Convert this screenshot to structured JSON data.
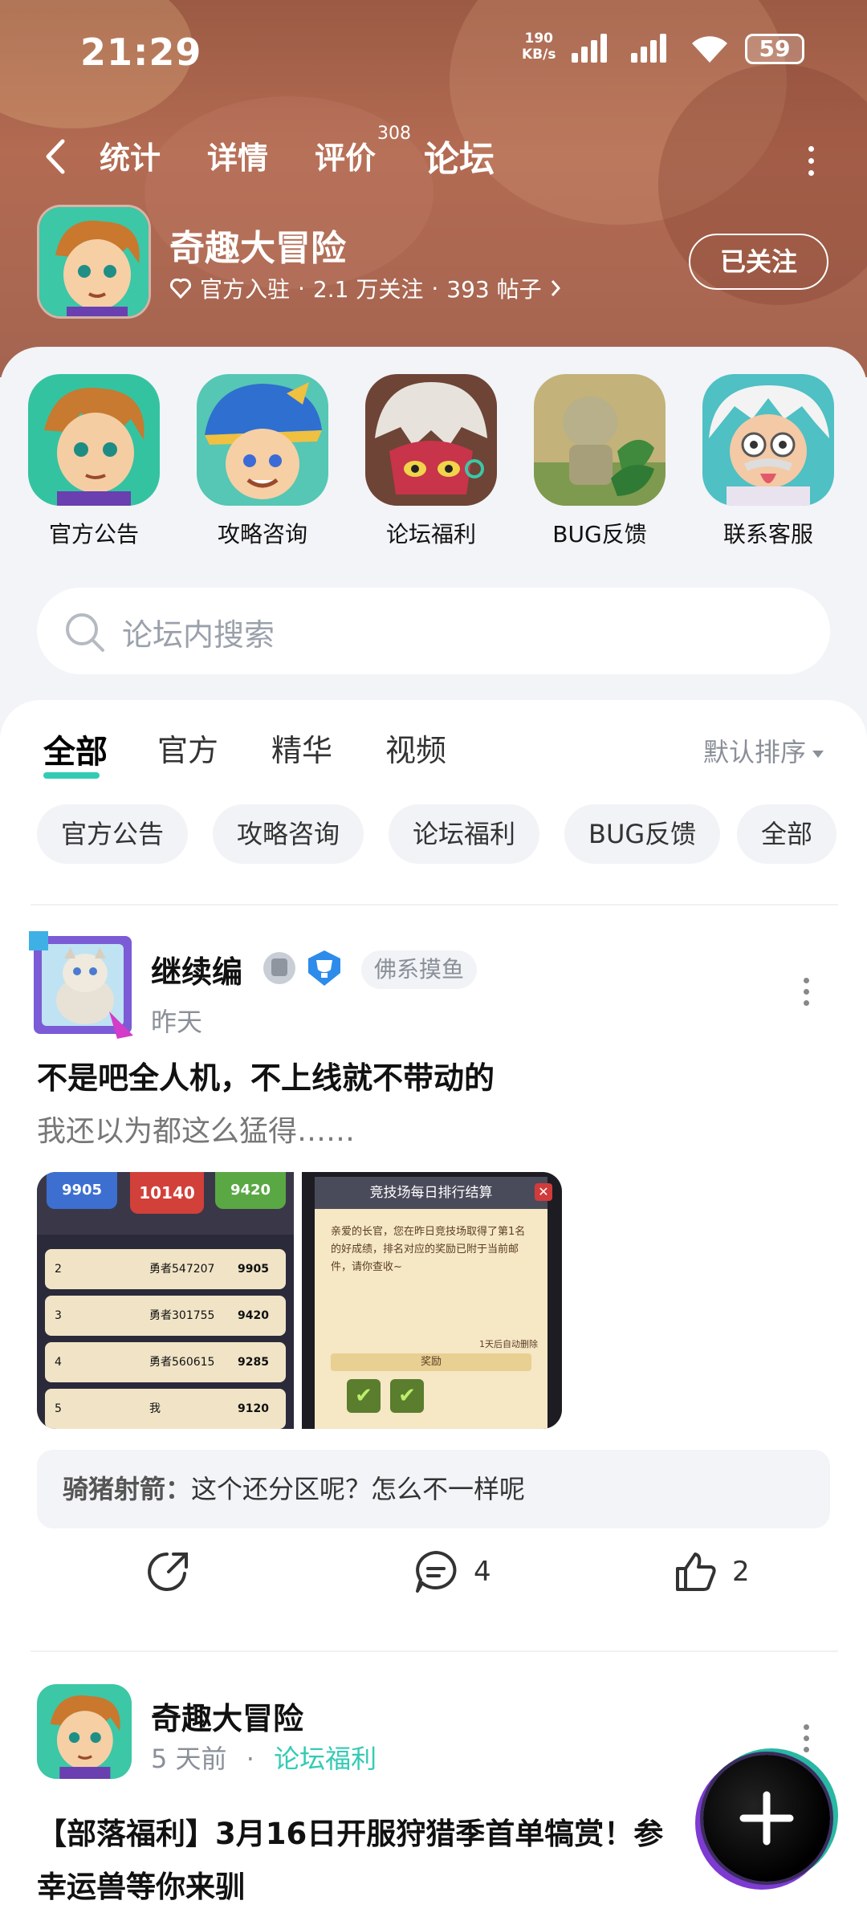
{
  "status_bar": {
    "time": "21:29",
    "net_speed_value": "190",
    "net_speed_unit": "KB/s",
    "battery": "59"
  },
  "nav": {
    "tabs": [
      {
        "label": "统计"
      },
      {
        "label": "详情"
      },
      {
        "label": "评价",
        "count": "308"
      },
      {
        "label": "论坛",
        "active": true
      }
    ]
  },
  "game": {
    "title": "奇趣大冒险",
    "badge": "官方入驻",
    "followers": "2.1 万关注",
    "posts": "393 帖子",
    "follow_label": "已关注"
  },
  "categories": [
    {
      "label": "官方公告",
      "icon": "hero-boy-icon"
    },
    {
      "label": "攻略咨询",
      "icon": "pirate-hero-icon"
    },
    {
      "label": "论坛福利",
      "icon": "dino-skull-icon"
    },
    {
      "label": "BUG反馈",
      "icon": "stone-statue-icon"
    },
    {
      "label": "联系客服",
      "icon": "scientist-icon"
    }
  ],
  "search": {
    "placeholder": "论坛内搜索"
  },
  "feed": {
    "tabs": [
      "全部",
      "官方",
      "精华",
      "视频"
    ],
    "sort_label": "默认排序",
    "chips": [
      "官方公告",
      "攻略咨询",
      "论坛福利",
      "BUG反馈",
      "全部"
    ]
  },
  "posts": [
    {
      "author": "继续编",
      "tag": "佛系摸鱼",
      "time": "昨天",
      "title": "不是吧全人机，不上线就不带动的",
      "excerpt": "我还以为都这么猛得……",
      "image1": {
        "top_scores": [
          "9905",
          "10140",
          "9420"
        ],
        "rows": [
          {
            "rank": "2",
            "name": "勇者547207",
            "score": "9905"
          },
          {
            "rank": "3",
            "name": "勇者301755",
            "score": "9420"
          },
          {
            "rank": "4",
            "name": "勇者560615",
            "score": "9285"
          },
          {
            "rank": "5",
            "name": "我",
            "score": "9120"
          }
        ]
      },
      "image2": {
        "title": "竞技场每日排行结算",
        "body": "亲爱的长官，您在昨日竞技场取得了第1名的好成绩，排名对应的奖励已附于当前邮件，请你查收~",
        "expire": "1天后自动删除",
        "reward_label": "奖励"
      },
      "comment_author": "骑猪射箭：",
      "comment_text": "这个还分区呢？怎么不一样呢",
      "comments": "4",
      "likes": "2"
    },
    {
      "author": "奇趣大冒险",
      "time": "5 天前",
      "category": "论坛福利",
      "title_line1": "【部落福利】3月16日开服狩猎季首单犒赏！参",
      "title_line2": "幸运兽等你来驯"
    }
  ],
  "colors": {
    "accent": "#33cbb4",
    "header": "#a8634d"
  }
}
